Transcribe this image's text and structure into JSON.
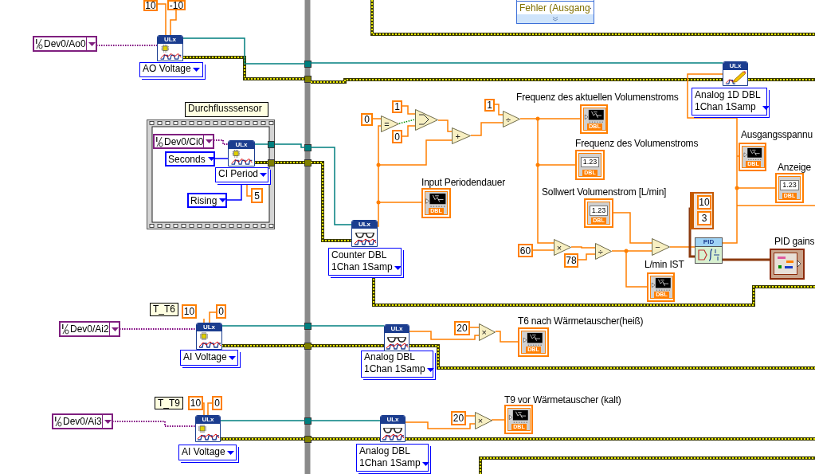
{
  "free_labels": [
    {
      "text": "Durchflusssensor"
    },
    {
      "text": "T_T6"
    },
    {
      "text": "T_T9"
    }
  ],
  "numeric_constants": [
    {
      "value": "10"
    },
    {
      "value": "-10"
    },
    {
      "value": "5"
    },
    {
      "value": "0"
    },
    {
      "value": "1"
    },
    {
      "value": "0"
    },
    {
      "value": "1"
    },
    {
      "value": "60"
    },
    {
      "value": "78"
    },
    {
      "value": "10"
    },
    {
      "value": "0"
    },
    {
      "value": "10"
    },
    {
      "value": "0"
    },
    {
      "value": "20"
    },
    {
      "value": "20"
    }
  ],
  "array_constant": {
    "values": [
      "10",
      "3"
    ]
  },
  "channel_constants": [
    {
      "value": "Dev0/Ao0"
    },
    {
      "value": "Dev0/Ci0"
    },
    {
      "value": "Dev0/Ai2"
    },
    {
      "value": "Dev0/Ai3"
    }
  ],
  "enum_constants": [
    {
      "value": "Seconds"
    },
    {
      "value": "Rising"
    }
  ],
  "selectors": [
    {
      "value": "AO Voltage"
    },
    {
      "value": "CI Period"
    },
    {
      "value": "Counter DBL\n1Chan 1Samp"
    },
    {
      "value": "Analog 1D DBL\n1Chan 1Samp"
    },
    {
      "value": "AI Voltage"
    },
    {
      "value": "Analog DBL\n1Chan 1Samp"
    },
    {
      "value": "AI Voltage"
    },
    {
      "value": "Analog DBL\n1Chan 1Samp"
    }
  ],
  "daq_nodes": [
    {
      "badge": "ULx",
      "kind": "create"
    },
    {
      "badge": "ULx",
      "kind": "create"
    },
    {
      "badge": "ULx",
      "kind": "read"
    },
    {
      "badge": "ULx",
      "kind": "write"
    },
    {
      "badge": "ULx",
      "kind": "create"
    },
    {
      "badge": "ULx",
      "kind": "read"
    },
    {
      "badge": "ULx",
      "kind": "create"
    },
    {
      "badge": "ULx",
      "kind": "read"
    }
  ],
  "functions": [
    {
      "kind": "equal",
      "symbol": "="
    },
    {
      "kind": "select"
    },
    {
      "kind": "add",
      "symbol": "+"
    },
    {
      "kind": "divide",
      "symbol": "÷"
    },
    {
      "kind": "multiply",
      "symbol": "×"
    },
    {
      "kind": "divide",
      "symbol": "÷"
    },
    {
      "kind": "subtract",
      "symbol": "−"
    },
    {
      "kind": "multiply",
      "symbol": "×"
    },
    {
      "kind": "multiply",
      "symbol": "×"
    }
  ],
  "terminals": [
    {
      "kind": "graph",
      "label": "Frequenz des aktuellen Volumenstroms",
      "type": "DBL"
    },
    {
      "kind": "numeric",
      "label": "Frequenz des Volumenstroms",
      "type": "DBL",
      "display": "1.23"
    },
    {
      "kind": "graph",
      "label": "Input Periodendauer",
      "type": "DBL"
    },
    {
      "kind": "numeric_control",
      "label": "Sollwert Volumenstrom [L/min]",
      "type": "DBL",
      "display": "1.23"
    },
    {
      "kind": "graph",
      "label": "L/min IST",
      "type": "DBL"
    },
    {
      "kind": "graph",
      "label": "Ausgangsspannu",
      "type": "DBL"
    },
    {
      "kind": "numeric",
      "label": "Anzeige",
      "type": "DBL",
      "display": "1.23"
    },
    {
      "kind": "cluster",
      "label": "PID gains"
    },
    {
      "kind": "graph",
      "label": "T6 nach Wärmetauscher(heiß)",
      "type": "DBL"
    },
    {
      "kind": "graph",
      "label": "T9 vor Wärmetauscher (kalt)",
      "type": "DBL"
    }
  ],
  "pid": {
    "badge": "PID"
  },
  "unbundle": {
    "item": "Fehler (Ausgang"
  }
}
